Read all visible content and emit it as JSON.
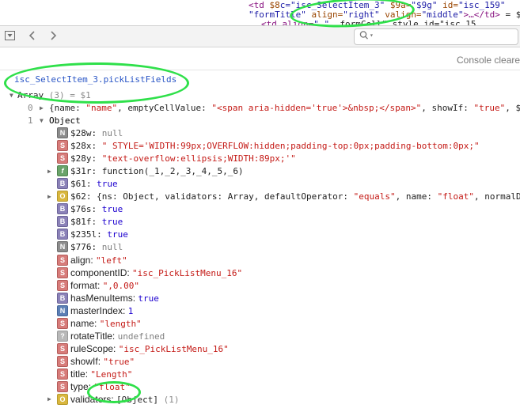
{
  "elements_strip": {
    "line1": [
      {
        "t": "<td ",
        "c": "tag"
      },
      {
        "t": "$8",
        "c": "attr"
      },
      {
        "t": "c=\"isc_SelectItem_3\"",
        "c": "val"
      },
      {
        "t": " $9a=",
        "c": "attr"
      },
      {
        "t": "\"$9g\"",
        "c": "val"
      },
      {
        "t": " id=",
        "c": "attr"
      },
      {
        "t": "\"isc_159\"",
        "c": "val"
      }
    ],
    "line2": [
      {
        "t": "\"formTitle\"",
        "c": "val"
      },
      {
        "t": " align=",
        "c": "attr"
      },
      {
        "t": "\"right\"",
        "c": "val"
      },
      {
        "t": " valign=",
        "c": "attr"
      },
      {
        "t": "\"middle\"",
        "c": "val"
      },
      {
        "t": ">…</td>",
        "c": "tag"
      },
      {
        "t": " = $",
        "c": "plain"
      }
    ],
    "line3": [
      {
        "t": "<td align=",
        "c": "tag"
      },
      {
        "t": "\"…\"",
        "c": "val"
      },
      {
        "t": " ",
        "c": "plain"
      },
      {
        "t": "…formCell\" style id=\"isc_15",
        "c": "plain"
      }
    ]
  },
  "toolbar": {
    "filter_icon": "filter-dropdown-icon",
    "back_icon": "chevron-left-icon",
    "forward_icon": "chevron-right-icon",
    "search_placeholder": ""
  },
  "console": {
    "cleared_text": "Console cleare",
    "command": "isc_SelectItem_3.pickListFields",
    "result_summary": {
      "type_label": "Array",
      "count": "(3)",
      "ref": "= $1"
    },
    "item0": {
      "index": "0",
      "text": [
        {
          "t": "{",
          "c": "plain"
        },
        {
          "t": "name",
          "c": "key"
        },
        {
          "t": ": ",
          "c": "plain"
        },
        {
          "t": "\"name\"",
          "c": "str"
        },
        {
          "t": ", ",
          "c": "plain"
        },
        {
          "t": "emptyCellValue",
          "c": "key"
        },
        {
          "t": ": ",
          "c": "plain"
        },
        {
          "t": "\"<span aria-hidden='true'>&nbsp;</span>\"",
          "c": "str"
        },
        {
          "t": ", ",
          "c": "plain"
        },
        {
          "t": "showIf",
          "c": "key"
        },
        {
          "t": ": ",
          "c": "plain"
        },
        {
          "t": "\"true\"",
          "c": "str"
        },
        {
          "t": ", $",
          "c": "plain"
        }
      ]
    },
    "item1": {
      "index": "1",
      "label": "Object"
    },
    "properties": [
      {
        "badge": "N",
        "cls": "b-N",
        "key": "$28w",
        "sep": ": ",
        "parts": [
          {
            "t": "null",
            "c": "nul"
          }
        ],
        "expand": false
      },
      {
        "badge": "S",
        "cls": "b-S",
        "key": "$28x",
        "sep": ": ",
        "parts": [
          {
            "t": "\" STYLE='WIDTH:99px;OVERFLOW:hidden;padding-top:0px;padding-bottom:0px;\"",
            "c": "str"
          }
        ],
        "expand": false
      },
      {
        "badge": "S",
        "cls": "b-S",
        "key": "$28y",
        "sep": ": ",
        "parts": [
          {
            "t": "\"text-overflow:ellipsis;WIDTH:89px;'\"",
            "c": "str"
          }
        ],
        "expand": false
      },
      {
        "badge": "f",
        "cls": "b-f",
        "key": "$31r",
        "sep": ": ",
        "parts": [
          {
            "t": "function(_1,_2,_3,_4,_5,_6)",
            "c": "fnc"
          }
        ],
        "expand": true
      },
      {
        "badge": "B",
        "cls": "b-B",
        "key": "$61",
        "sep": ": ",
        "parts": [
          {
            "t": "true",
            "c": "bool"
          }
        ],
        "expand": false
      },
      {
        "badge": "O",
        "cls": "b-O",
        "key": "$62",
        "sep": ": ",
        "parts": [
          {
            "t": "{ns: Object, validators: Array, defaultOperator: ",
            "c": "plain"
          },
          {
            "t": "\"equals\"",
            "c": "str"
          },
          {
            "t": ", name: ",
            "c": "plain"
          },
          {
            "t": "\"float\"",
            "c": "str"
          },
          {
            "t": ", normalDi",
            "c": "plain"
          }
        ],
        "expand": true
      },
      {
        "badge": "B",
        "cls": "b-B",
        "key": "$76s",
        "sep": ": ",
        "parts": [
          {
            "t": "true",
            "c": "bool"
          }
        ],
        "expand": false
      },
      {
        "badge": "B",
        "cls": "b-B",
        "key": "$81f",
        "sep": ": ",
        "parts": [
          {
            "t": "true",
            "c": "bool"
          }
        ],
        "expand": false
      },
      {
        "badge": "B",
        "cls": "b-B",
        "key": "$235l",
        "sep": ": ",
        "parts": [
          {
            "t": "true",
            "c": "bool"
          }
        ],
        "expand": false
      },
      {
        "badge": "N",
        "cls": "b-N",
        "key": "$776",
        "sep": ": ",
        "parts": [
          {
            "t": "null",
            "c": "nul"
          }
        ],
        "expand": false
      },
      {
        "badge": "S",
        "cls": "b-S",
        "key": "align",
        "sep": ": ",
        "parts": [
          {
            "t": "\"left\"",
            "c": "str"
          }
        ],
        "expand": false,
        "sans": true
      },
      {
        "badge": "S",
        "cls": "b-S",
        "key": "componentID",
        "sep": ": ",
        "parts": [
          {
            "t": "\"isc_PickListMenu_16\"",
            "c": "str"
          }
        ],
        "expand": false,
        "sans": true
      },
      {
        "badge": "S",
        "cls": "b-S",
        "key": "format",
        "sep": ": ",
        "parts": [
          {
            "t": "\",0.00\"",
            "c": "str"
          }
        ],
        "expand": false,
        "sans": true
      },
      {
        "badge": "B",
        "cls": "b-B",
        "key": "hasMenuItems",
        "sep": ": ",
        "parts": [
          {
            "t": "true",
            "c": "bool"
          }
        ],
        "expand": false,
        "sans": true
      },
      {
        "badge": "N",
        "cls": "b-NB",
        "key": "masterIndex",
        "sep": ": ",
        "parts": [
          {
            "t": "1",
            "c": "num"
          }
        ],
        "expand": false,
        "sans": true
      },
      {
        "badge": "S",
        "cls": "b-S",
        "key": "name",
        "sep": ": ",
        "parts": [
          {
            "t": "\"length\"",
            "c": "str"
          }
        ],
        "expand": false,
        "sans": true
      },
      {
        "badge": "?",
        "cls": "b-Q",
        "key": "rotateTitle",
        "sep": ": ",
        "parts": [
          {
            "t": "undefined",
            "c": "undef"
          }
        ],
        "expand": false,
        "sans": true
      },
      {
        "badge": "S",
        "cls": "b-S",
        "key": "ruleScope",
        "sep": ": ",
        "parts": [
          {
            "t": "\"isc_PickListMenu_16\"",
            "c": "str"
          }
        ],
        "expand": false,
        "sans": true
      },
      {
        "badge": "S",
        "cls": "b-S",
        "key": "showIf",
        "sep": ": ",
        "parts": [
          {
            "t": "\"true\"",
            "c": "str"
          }
        ],
        "expand": false,
        "sans": true
      },
      {
        "badge": "S",
        "cls": "b-S",
        "key": "title",
        "sep": ": ",
        "parts": [
          {
            "t": "\"Length\"",
            "c": "str"
          }
        ],
        "expand": false,
        "sans": true
      },
      {
        "badge": "S",
        "cls": "b-S",
        "key": "type",
        "sep": ": ",
        "parts": [
          {
            "t": "\"float\"",
            "c": "str"
          }
        ],
        "expand": false,
        "sans": true
      },
      {
        "badge": "O",
        "cls": "b-O",
        "key": "validators",
        "sep": ": ",
        "parts": [
          {
            "t": "[Object]",
            "c": "plain"
          },
          {
            "t": " (1)",
            "c": "dim"
          }
        ],
        "expand": true,
        "sans": true
      }
    ]
  },
  "colors": {
    "annotation_green": "#2fe04a",
    "string_red": "#c41a16",
    "command_blue": "#2a56c6"
  }
}
